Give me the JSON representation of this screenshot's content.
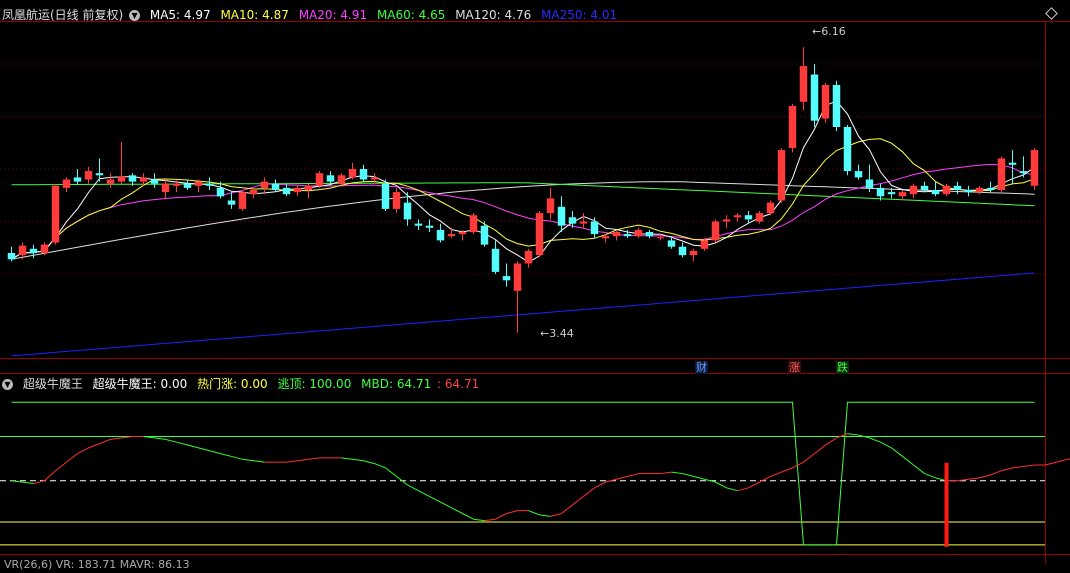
{
  "main_header": {
    "stock_title": "凤凰航运(日线 前复权)",
    "ma": [
      {
        "label": "MA5: 4.97",
        "color": "#ffffff"
      },
      {
        "label": "MA10: 4.87",
        "color": "#ffff40"
      },
      {
        "label": "MA20: 4.91",
        "color": "#ff40ff"
      },
      {
        "label": "MA60: 4.65",
        "color": "#40ff40"
      },
      {
        "label": "MA120: 4.76",
        "color": "#dddddd"
      },
      {
        "label": "MA250: 4.01",
        "color": "#2020ff"
      }
    ]
  },
  "price_labels": {
    "high": "6.16",
    "low": "3.44"
  },
  "event_tags": [
    {
      "text": "财",
      "color": "#6fa0ff",
      "bg": "#102050"
    },
    {
      "text": "涨",
      "color": "#ff6060",
      "bg": "#401010"
    },
    {
      "text": "跌",
      "color": "#40ff40",
      "bg": "#103010"
    }
  ],
  "indicator_header": {
    "name": "超级牛魔王",
    "items": [
      {
        "label": "超级牛魔王: 0.00",
        "color": "#ffffff"
      },
      {
        "label": "热门涨: 0.00",
        "color": "#ffff40"
      },
      {
        "label": "逃顶: 100.00",
        "color": "#40ff40"
      },
      {
        "label": "MBD: 64.71",
        "color": "#40ff40"
      },
      {
        "label": ": 64.71",
        "color": "#ff4040"
      }
    ]
  },
  "bottom_header_partial": "VR(26,6) VR: 183.71 MAVR: 86.13",
  "colors": {
    "up": "#ff3b3b",
    "down": "#54fcfc",
    "grid": "#7a0000"
  },
  "chart_data": {
    "type": "candlestick",
    "ohlc": [
      [
        4.2,
        4.26,
        4.12,
        4.14
      ],
      [
        4.18,
        4.3,
        4.14,
        4.27
      ],
      [
        4.24,
        4.28,
        4.15,
        4.2
      ],
      [
        4.2,
        4.3,
        4.18,
        4.28
      ],
      [
        4.3,
        4.86,
        4.28,
        4.84
      ],
      [
        4.82,
        4.92,
        4.78,
        4.9
      ],
      [
        4.92,
        5.0,
        4.85,
        4.88
      ],
      [
        4.9,
        5.02,
        4.86,
        4.98
      ],
      [
        4.96,
        5.1,
        4.88,
        4.94
      ],
      [
        4.86,
        4.96,
        4.82,
        4.9
      ],
      [
        4.88,
        5.26,
        4.86,
        4.93
      ],
      [
        4.94,
        4.96,
        4.84,
        4.88
      ],
      [
        4.88,
        4.96,
        4.84,
        4.92
      ],
      [
        4.9,
        4.96,
        4.82,
        4.86
      ],
      [
        4.78,
        4.9,
        4.72,
        4.86
      ],
      [
        4.84,
        4.9,
        4.78,
        4.86
      ],
      [
        4.86,
        4.9,
        4.8,
        4.82
      ],
      [
        4.84,
        4.9,
        4.78,
        4.88
      ],
      [
        4.86,
        4.92,
        4.8,
        4.84
      ],
      [
        4.82,
        4.88,
        4.72,
        4.74
      ],
      [
        4.7,
        4.78,
        4.62,
        4.66
      ],
      [
        4.62,
        4.8,
        4.6,
        4.78
      ],
      [
        4.76,
        4.82,
        4.72,
        4.8
      ],
      [
        4.82,
        4.92,
        4.76,
        4.88
      ],
      [
        4.86,
        4.9,
        4.78,
        4.8
      ],
      [
        4.82,
        4.86,
        4.74,
        4.76
      ],
      [
        4.78,
        4.84,
        4.74,
        4.82
      ],
      [
        4.8,
        4.86,
        4.72,
        4.84
      ],
      [
        4.84,
        4.98,
        4.82,
        4.96
      ],
      [
        4.94,
        4.98,
        4.84,
        4.88
      ],
      [
        4.86,
        4.96,
        4.84,
        4.94
      ],
      [
        4.92,
        5.06,
        4.9,
        5.0
      ],
      [
        5.0,
        5.04,
        4.88,
        4.9
      ],
      [
        4.9,
        4.96,
        4.86,
        4.92
      ],
      [
        4.86,
        4.9,
        4.6,
        4.62
      ],
      [
        4.62,
        4.82,
        4.58,
        4.78
      ],
      [
        4.68,
        4.78,
        4.46,
        4.52
      ],
      [
        4.48,
        4.52,
        4.42,
        4.46
      ],
      [
        4.46,
        4.52,
        4.4,
        4.44
      ],
      [
        4.42,
        4.48,
        4.3,
        4.32
      ],
      [
        4.36,
        4.44,
        4.34,
        4.38
      ],
      [
        4.38,
        4.42,
        4.32,
        4.4
      ],
      [
        4.4,
        4.58,
        4.38,
        4.56
      ],
      [
        4.46,
        4.5,
        4.26,
        4.28
      ],
      [
        4.24,
        4.32,
        4.0,
        4.02
      ],
      [
        3.98,
        4.1,
        3.88,
        3.94
      ],
      [
        3.84,
        4.12,
        3.44,
        4.1
      ],
      [
        4.1,
        4.24,
        4.06,
        4.22
      ],
      [
        4.18,
        4.6,
        4.16,
        4.58
      ],
      [
        4.58,
        4.82,
        4.52,
        4.72
      ],
      [
        4.64,
        4.74,
        4.4,
        4.46
      ],
      [
        4.54,
        4.6,
        4.44,
        4.48
      ],
      [
        4.48,
        4.58,
        4.44,
        4.5
      ],
      [
        4.5,
        4.54,
        4.34,
        4.38
      ],
      [
        4.34,
        4.38,
        4.3,
        4.36
      ],
      [
        4.36,
        4.42,
        4.32,
        4.4
      ],
      [
        4.38,
        4.42,
        4.34,
        4.36
      ],
      [
        4.36,
        4.44,
        4.34,
        4.42
      ],
      [
        4.4,
        4.42,
        4.34,
        4.36
      ],
      [
        4.34,
        4.38,
        4.32,
        4.35
      ],
      [
        4.32,
        4.36,
        4.24,
        4.26
      ],
      [
        4.26,
        4.3,
        4.16,
        4.18
      ],
      [
        4.18,
        4.24,
        4.12,
        4.22
      ],
      [
        4.24,
        4.34,
        4.22,
        4.32
      ],
      [
        4.32,
        4.52,
        4.3,
        4.5
      ],
      [
        4.5,
        4.56,
        4.44,
        4.52
      ],
      [
        4.54,
        4.58,
        4.5,
        4.56
      ],
      [
        4.56,
        4.6,
        4.48,
        4.52
      ],
      [
        4.5,
        4.6,
        4.48,
        4.58
      ],
      [
        4.58,
        4.7,
        4.56,
        4.68
      ],
      [
        4.7,
        5.2,
        4.68,
        5.18
      ],
      [
        5.2,
        5.62,
        5.16,
        5.6
      ],
      [
        5.64,
        6.16,
        5.56,
        5.98
      ],
      [
        5.9,
        6.0,
        5.4,
        5.46
      ],
      [
        5.48,
        5.82,
        5.44,
        5.8
      ],
      [
        5.8,
        5.84,
        5.36,
        5.4
      ],
      [
        5.4,
        5.42,
        4.94,
        4.98
      ],
      [
        4.98,
        5.04,
        4.9,
        4.92
      ],
      [
        4.9,
        5.04,
        4.78,
        4.82
      ],
      [
        4.82,
        4.86,
        4.7,
        4.74
      ],
      [
        4.78,
        4.82,
        4.72,
        4.76
      ],
      [
        4.74,
        4.8,
        4.7,
        4.78
      ],
      [
        4.76,
        4.86,
        4.72,
        4.84
      ],
      [
        4.84,
        4.88,
        4.78,
        4.8
      ],
      [
        4.8,
        4.88,
        4.74,
        4.76
      ],
      [
        4.76,
        4.86,
        4.74,
        4.84
      ],
      [
        4.84,
        4.88,
        4.76,
        4.8
      ],
      [
        4.8,
        4.84,
        4.74,
        4.78
      ],
      [
        4.78,
        4.84,
        4.76,
        4.82
      ],
      [
        4.82,
        4.88,
        4.78,
        4.8
      ],
      [
        4.8,
        5.12,
        4.78,
        5.1
      ],
      [
        5.06,
        5.18,
        4.86,
        5.04
      ],
      [
        4.98,
        5.12,
        4.92,
        4.96
      ],
      [
        4.84,
        5.2,
        4.8,
        5.18
      ]
    ],
    "price_range": [
      3.2,
      6.4
    ],
    "ma_lines": [
      {
        "name": "MA5",
        "color": "#ffffff"
      },
      {
        "name": "MA10",
        "color": "#ffff40"
      },
      {
        "name": "MA20",
        "color": "#ff40ff"
      },
      {
        "name": "MA60",
        "color": "#40ff40",
        "start": 4.85,
        "mid": 4.87,
        "end": 4.65
      },
      {
        "name": "MA120",
        "color": "#dddddd",
        "start": 4.14,
        "mid": 4.88,
        "end": 4.76
      },
      {
        "name": "MA250",
        "color": "#2020ff",
        "start": 3.22,
        "end": 4.01
      }
    ],
    "indicator": {
      "range": [
        -5,
        110
      ],
      "upper_green": 100,
      "band_green": 76,
      "dash_white": 45,
      "band_yellow": 16,
      "base_yellow": 0,
      "mbd": [
        45,
        44,
        43,
        45,
        52,
        58,
        64,
        68,
        71,
        74,
        75,
        76,
        76,
        75,
        74,
        72,
        70,
        68,
        66,
        64,
        62,
        60,
        59,
        58,
        58,
        58,
        59,
        60,
        61,
        61,
        61,
        60,
        59,
        57,
        54,
        48,
        42,
        38,
        34,
        30,
        26,
        22,
        18,
        17,
        18,
        22,
        24,
        24,
        21,
        20,
        22,
        28,
        34,
        40,
        44,
        46,
        48,
        50,
        50,
        50,
        51,
        50,
        48,
        46,
        44,
        40,
        38,
        40,
        44,
        48,
        51,
        54,
        58,
        64,
        70,
        75,
        78,
        77,
        75,
        72,
        68,
        62,
        56,
        50,
        47,
        45,
        45,
        46,
        47,
        49,
        52,
        54,
        55,
        56,
        56,
        58,
        60,
        61,
        62,
        64
      ]
    }
  }
}
